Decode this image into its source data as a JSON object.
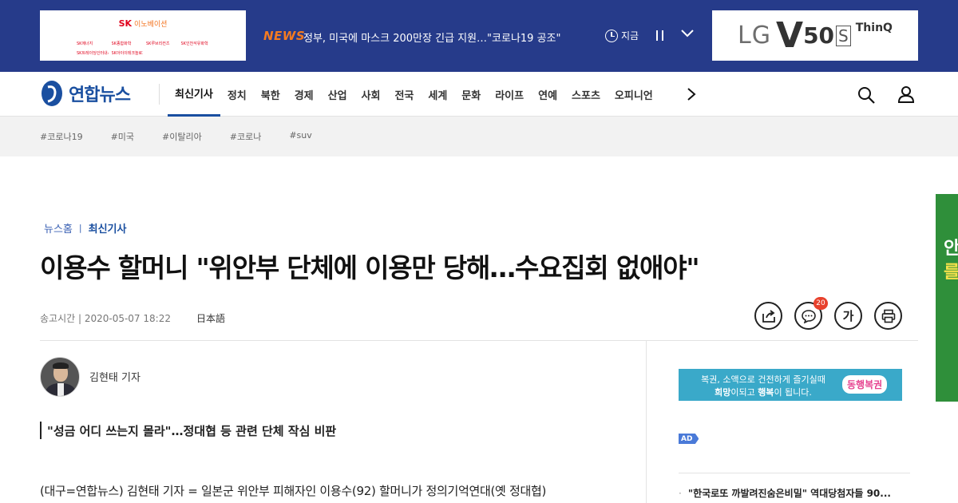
{
  "top_banner": {
    "ad_left": {
      "brand": "SK",
      "subtitle": "이노베이션",
      "affiliates": [
        "SK에너지",
        "SK종합화학",
        "SK루브리컨츠",
        "SK인천석유화학",
        "SK트레이딩인터내셔널",
        "SK아이이테크놀로지"
      ]
    },
    "news_label": "NEWS",
    "news_headline": "정부, 미국에 마스크 200만장 긴급 지원…\"코로나19 공조\"",
    "time_label": "지금",
    "ad_right": {
      "brand": "LG",
      "model_v": "V",
      "model_num": "50",
      "model_s": "S",
      "suffix": "ThinQ"
    }
  },
  "nav": {
    "logo_text": "연합뉴스",
    "items": [
      "최신기사",
      "정치",
      "북한",
      "경제",
      "산업",
      "사회",
      "전국",
      "세계",
      "문화",
      "라이프",
      "연예",
      "스포츠",
      "오피니언"
    ]
  },
  "hashtags": [
    "#코로나19",
    "#미국",
    "#이탈리아",
    "#코로나",
    "#suv"
  ],
  "article": {
    "breadcrumb": {
      "home": "뉴스홈",
      "separator": "|",
      "current": "최신기사"
    },
    "headline": "이용수 할머니 \"위안부 단체에 이용만 당해…수요집회 없애야\"",
    "send_time": "송고시간 | 2020-05-07 18:22",
    "language_link": "日本語",
    "comment_count": "20",
    "font_button_label": "가",
    "reporter": "김현태 기자",
    "subhead": "\"성금 어디 쓰는지 몰라\"…정대협 등 관련 단체 작심 비판",
    "body_first_line": "(대구=연합뉴스) 김현태 기자 = 일본군 위안부 피해자인 이용수(92) 할머니가 정의기억연대(옛 정대협)"
  },
  "sidebar": {
    "ad_lotto": {
      "line1": "복권, 소액으로 건전하게 즐기실때",
      "line2_a": "희망",
      "line2_b": "이되고 ",
      "line2_c": "행복",
      "line2_d": "이 됩니다.",
      "brand": "동행복권"
    },
    "ad_badge": "AD",
    "top_link": "\"한국로또 까발려진숨은비밀\" 역대당첨자들 90..."
  },
  "side_ad": {
    "line1": "안",
    "line2": "를"
  },
  "colors": {
    "topbar": "#263b8a",
    "accent": "#1a4fa0",
    "news_label": "#f47b20",
    "badge": "#e8412c"
  }
}
